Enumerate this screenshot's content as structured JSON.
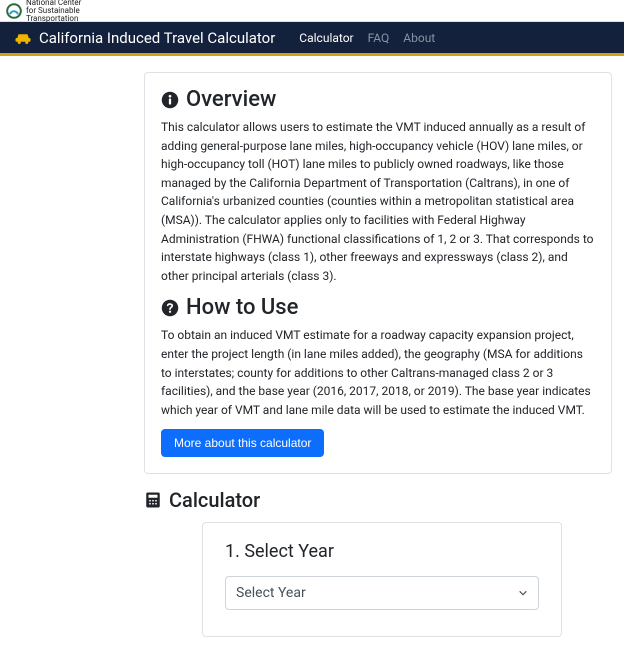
{
  "org": {
    "name_line1": "National Center",
    "name_line2": "for Sustainable",
    "name_line3": "Transportation"
  },
  "nav": {
    "brand": "California Induced Travel Calculator",
    "links": [
      {
        "label": "Calculator",
        "active": true
      },
      {
        "label": "FAQ",
        "active": false
      },
      {
        "label": "About",
        "active": false
      }
    ]
  },
  "overview": {
    "heading": "Overview",
    "body": "This calculator allows users to estimate the VMT induced annually as a result of adding general-purpose lane miles, high-occupancy vehicle (HOV) lane miles, or high-occupancy toll (HOT) lane miles to publicly owned roadways, like those managed by the California Department of Transportation (Caltrans), in one of California's urbanized counties (counties within a metropolitan statistical area (MSA)). The calculator applies only to facilities with Federal Highway Administration (FHWA) functional classifications of 1, 2 or 3. That corresponds to interstate highways (class 1), other freeways and expressways (class 2), and other principal arterials (class 3)."
  },
  "howto": {
    "heading": "How to Use",
    "body": "To obtain an induced VMT estimate for a roadway capacity expansion project, enter the project length (in lane miles added), the geography (MSA for additions to interstates; county for additions to other Caltrans-managed class 2 or 3 facilities), and the base year (2016, 2017, 2018, or 2019). The base year indicates which year of VMT and lane mile data will be used to estimate the induced VMT.",
    "more_btn": "More about this calculator"
  },
  "calculator": {
    "heading": "Calculator",
    "step1": {
      "title": "1. Select Year",
      "placeholder": "Select Year"
    }
  }
}
